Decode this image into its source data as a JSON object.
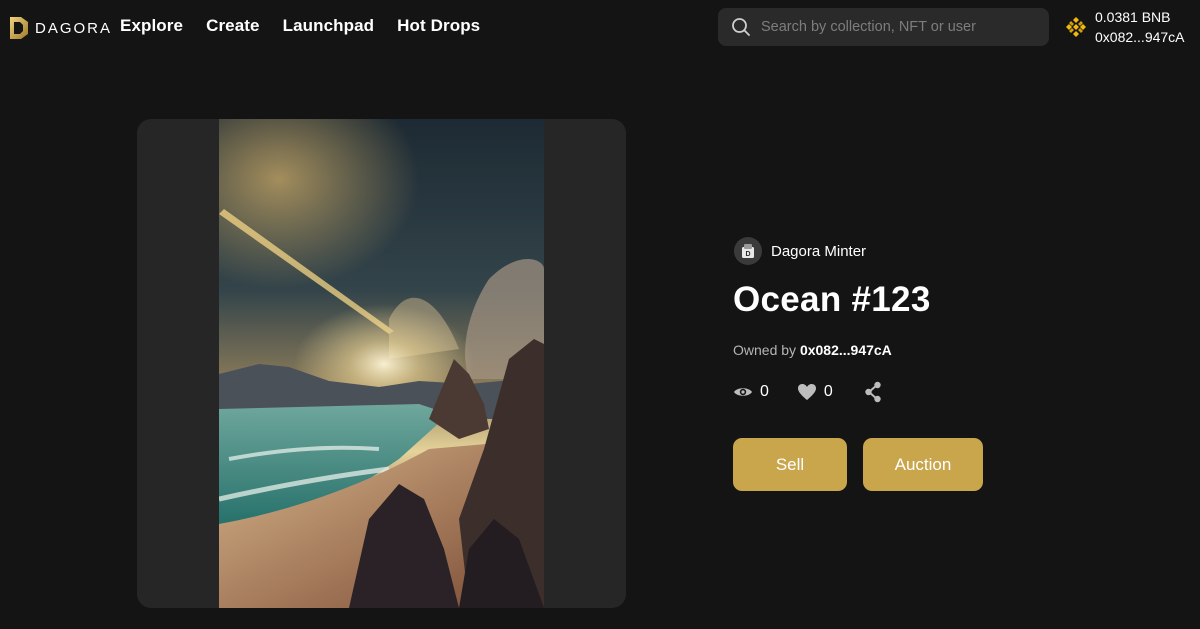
{
  "header": {
    "logo_text": "DAGORA",
    "nav": [
      {
        "label": "Explore"
      },
      {
        "label": "Create"
      },
      {
        "label": "Launchpad"
      },
      {
        "label": "Hot Drops"
      }
    ],
    "search": {
      "placeholder": "Search by collection, NFT or user",
      "value": ""
    },
    "wallet": {
      "balance": "0.0381 BNB",
      "address": "0x082...947cA"
    }
  },
  "nft": {
    "creator_name": "Dagora Minter",
    "title": "Ocean #123",
    "owned_by_label": "Owned by",
    "owner_address": "0x082...947cA",
    "views": "0",
    "likes": "0"
  },
  "actions": {
    "sell_label": "Sell",
    "auction_label": "Auction"
  },
  "colors": {
    "background": "#141414",
    "panel": "#262626",
    "accent_gold": "#c9a54c",
    "search_bg": "#2a2a2a"
  },
  "icons": [
    "dagora-logo-icon",
    "search-icon",
    "bnb-icon",
    "creator-avatar-icon",
    "eye-icon",
    "heart-icon",
    "share-icon"
  ]
}
